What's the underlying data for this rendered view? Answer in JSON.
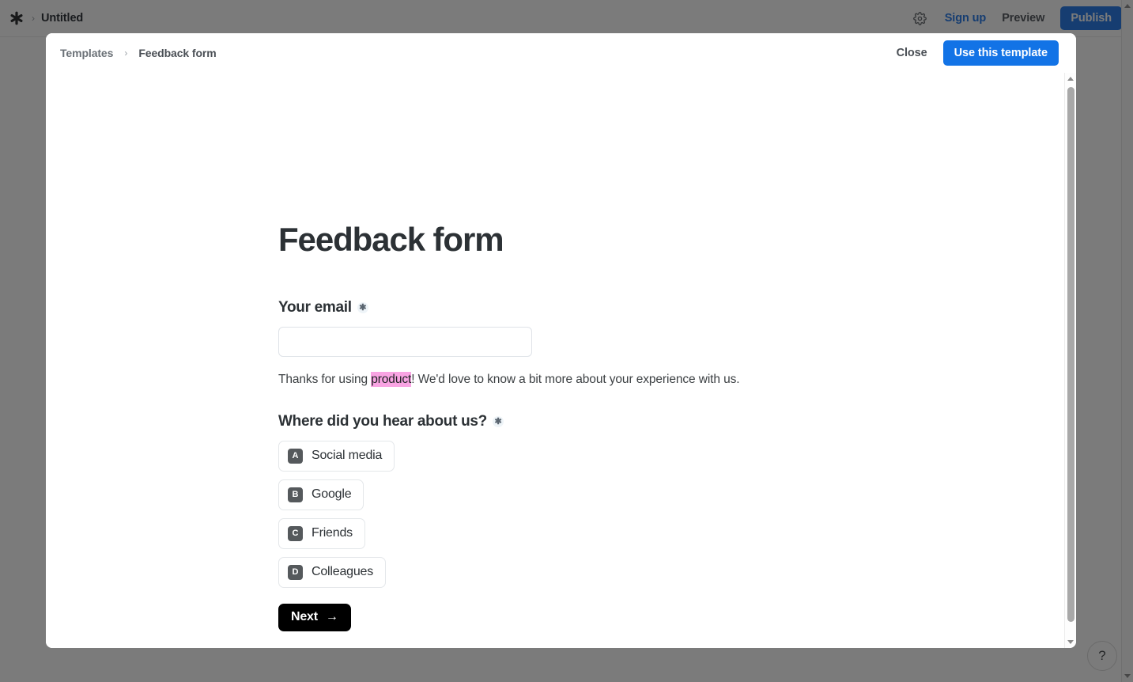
{
  "topbar": {
    "logo_icon": "asterisk-logo-icon",
    "breadcrumb_separator": "›",
    "document_title": "Untitled",
    "settings_icon": "gear-icon",
    "signup_label": "Sign up",
    "preview_label": "Preview",
    "publish_label": "Publish",
    "accent_color": "#1a73e8"
  },
  "help": {
    "label": "?",
    "icon": "question-mark-icon"
  },
  "modal": {
    "breadcrumb": {
      "root_label": "Templates",
      "separator": "›",
      "current_label": "Feedback form"
    },
    "close_label": "Close",
    "use_template_label": "Use this template",
    "use_template_color": "#1273e6"
  },
  "form": {
    "title": "Feedback form",
    "required_marker": "✳",
    "email_field": {
      "label": "Your email",
      "required": true,
      "value": "",
      "placeholder": ""
    },
    "helper": {
      "before": "Thanks for using ",
      "highlight": "product",
      "highlight_color": "#f9a4e3",
      "after": "! We'd love to know a bit more about your experience with us."
    },
    "question": {
      "label": "Where did you hear about us?",
      "required": true,
      "options": [
        {
          "key": "A",
          "label": "Social media"
        },
        {
          "key": "B",
          "label": "Google"
        },
        {
          "key": "C",
          "label": "Friends"
        },
        {
          "key": "D",
          "label": "Colleagues"
        }
      ]
    },
    "next_button": {
      "label": "Next",
      "icon": "arrow-right-icon",
      "glyph": "→"
    }
  },
  "scrollbars": {
    "up_arrow_icon": "chevron-up-icon",
    "down_arrow_icon": "chevron-down-icon"
  }
}
